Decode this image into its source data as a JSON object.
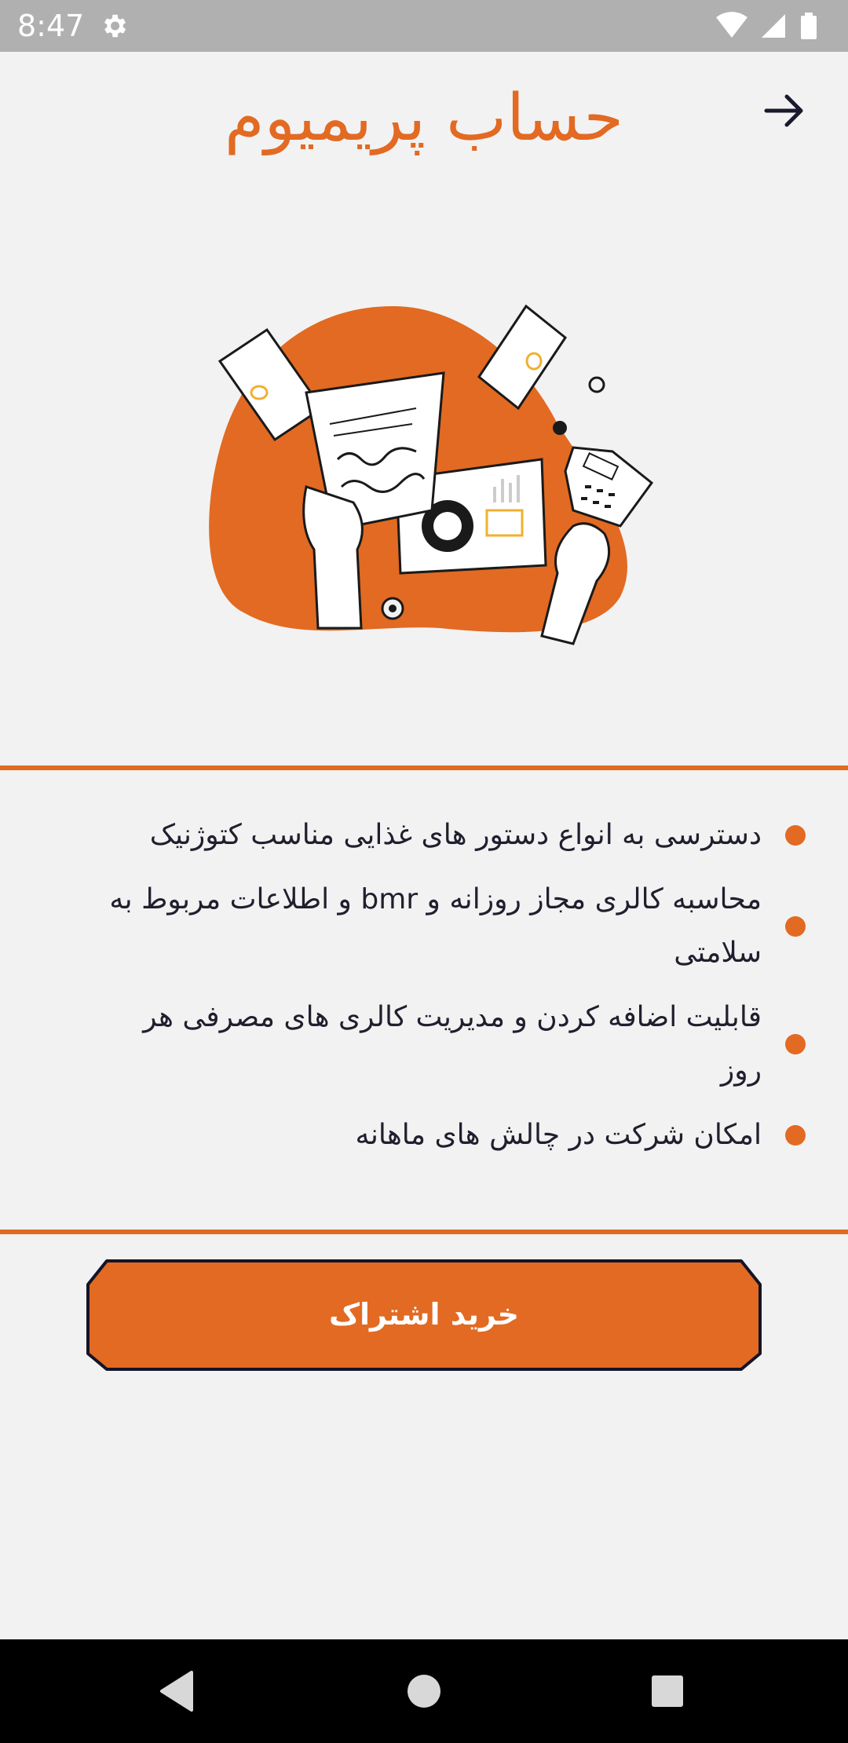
{
  "status_bar": {
    "time": "8:47",
    "icons": [
      "settings-icon",
      "wifi-icon",
      "signal-icon",
      "battery-icon"
    ]
  },
  "header": {
    "title": "حساب پریمیوم",
    "back_icon": "arrow-right-icon"
  },
  "illustration": {
    "icon": "finance-illustration"
  },
  "features": {
    "items": [
      "دسترسی به انواع دستور های غذایی مناسب کتوژنیک",
      "محاسبه کالری مجاز روزانه و bmr و اطلاعات مربوط به سلامتی",
      "قابلیت اضافه کردن و مدیریت کالری های مصرفی هر روز",
      "امکان شرکت در چالش های ماهانه"
    ]
  },
  "purchase": {
    "button_label": "خرید اشتراک"
  },
  "nav_bar": {
    "icons": [
      "back-triangle-icon",
      "home-circle-icon",
      "recents-square-icon"
    ]
  },
  "colors": {
    "accent": "#e26a22",
    "text": "#1f1f2e",
    "background": "#f2f2f2",
    "status_bar": "#b0b0b0"
  }
}
